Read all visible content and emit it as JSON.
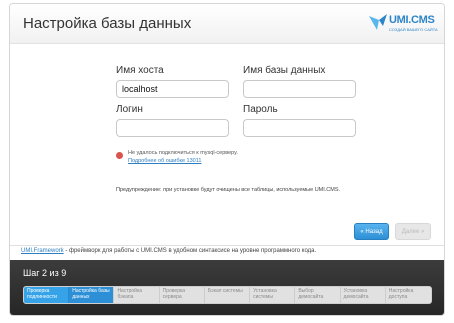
{
  "header": {
    "title": "Настройка базы данных"
  },
  "logo": {
    "brand": "UMI.CMS",
    "tagline": "СОЗДАЙ ВАШЕГО САЙТА"
  },
  "form": {
    "host_label": "Имя хоста",
    "host_value": "localhost",
    "db_label": "Имя базы данных",
    "db_value": "",
    "login_label": "Логин",
    "login_value": "",
    "password_label": "Пароль",
    "password_value": ""
  },
  "error": {
    "message": "Не удалось подключиться к mysql-серверу.",
    "details_link": "Подробнее об ошибке 13011"
  },
  "warning": "Предупреждение: при установке будут очищены все таблицы, используемые UMI.CMS.",
  "buttons": {
    "back": "« Назад",
    "forward": "Далее »"
  },
  "footnote": {
    "link": "UMI.Framework",
    "text": " - фреймворк для работы с UMI.CMS в удобном синтаксисе на уровне программного кода."
  },
  "stepbar": {
    "title": "Шаг 2 из 9",
    "steps": [
      {
        "label": "Проверка подлинности",
        "state": "done"
      },
      {
        "label": "Настройка базы данных",
        "state": "current"
      },
      {
        "label": "Настройка бэкапа",
        "state": "pending"
      },
      {
        "label": "Проверка сервера",
        "state": "pending"
      },
      {
        "label": "Бэкап системы",
        "state": "pending"
      },
      {
        "label": "Установка системы",
        "state": "pending"
      },
      {
        "label": "Выбор демосайта",
        "state": "pending"
      },
      {
        "label": "Установка демосайта",
        "state": "pending"
      },
      {
        "label": "Настройка доступа",
        "state": "pending"
      }
    ]
  },
  "colors": {
    "accent": "#2d8fd6",
    "error": "#d9534f",
    "dark_bar": "#262626"
  }
}
